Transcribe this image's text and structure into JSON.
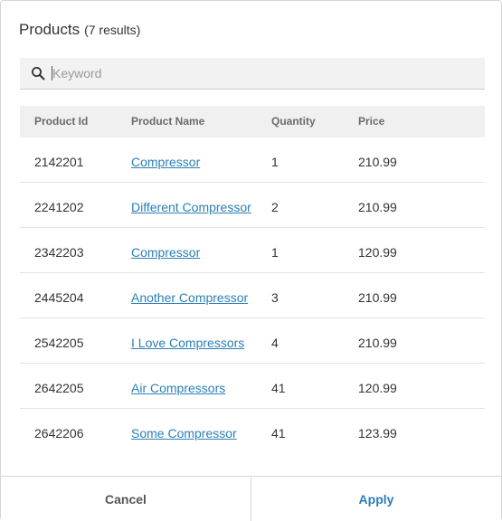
{
  "header": {
    "title": "Products",
    "count": "(7 results)"
  },
  "search": {
    "placeholder": "Keyword",
    "value": ""
  },
  "table": {
    "columns": [
      "Product Id",
      "Product Name",
      "Quantity",
      "Price"
    ],
    "rows": [
      {
        "id": "2142201",
        "name": "Compressor",
        "quantity": "1",
        "price": "210.99"
      },
      {
        "id": "2241202",
        "name": "Different Compressor",
        "quantity": "2",
        "price": "210.99"
      },
      {
        "id": "2342203",
        "name": "Compressor",
        "quantity": "1",
        "price": "120.99"
      },
      {
        "id": "2445204",
        "name": "Another Compressor",
        "quantity": "3",
        "price": "210.99"
      },
      {
        "id": "2542205",
        "name": "I Love Compressors",
        "quantity": "4",
        "price": "210.99"
      },
      {
        "id": "2642205",
        "name": "Air Compressors",
        "quantity": "41",
        "price": "120.99"
      },
      {
        "id": "2642206",
        "name": "Some Compressor",
        "quantity": "41",
        "price": "123.99"
      }
    ]
  },
  "footer": {
    "cancel_label": "Cancel",
    "apply_label": "Apply"
  },
  "colors": {
    "accent": "#2b7fb5",
    "header_bg": "#f0f0f0",
    "search_bg": "#f2f2f2"
  }
}
